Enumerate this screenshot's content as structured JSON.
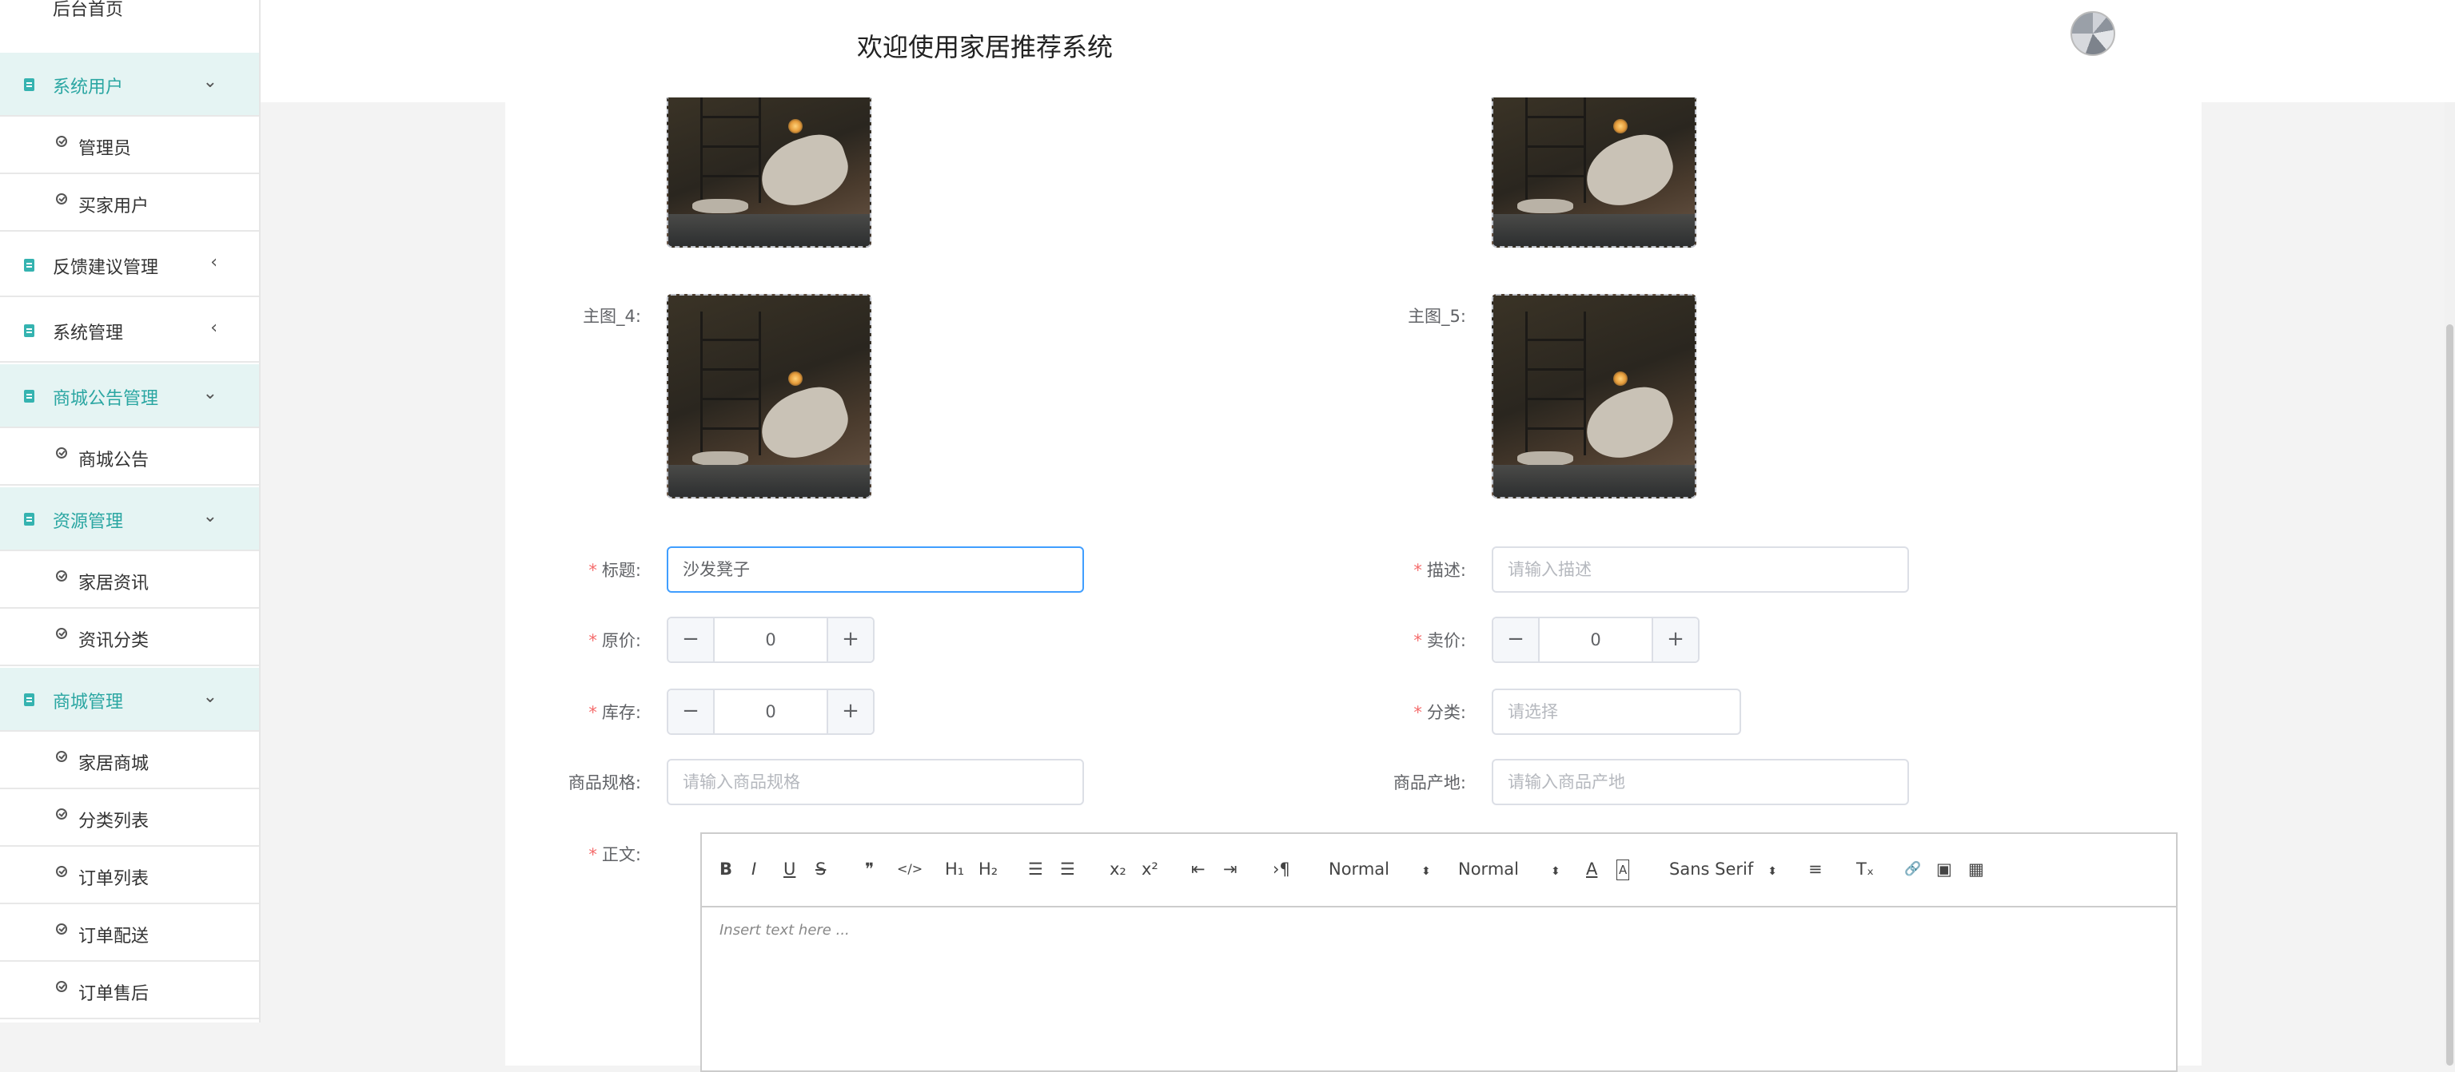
{
  "sidebar": {
    "home": "后台首页",
    "groups": [
      {
        "label": "系统用户",
        "arrow": "⌄",
        "children": [
          "管理员",
          "买家用户"
        ]
      },
      {
        "label": "反馈建议管理",
        "arrow": "‹"
      },
      {
        "label": "系统管理",
        "arrow": "‹"
      },
      {
        "label": "商城公告管理",
        "arrow": "⌄",
        "children": [
          "商城公告"
        ]
      },
      {
        "label": "资源管理",
        "arrow": "⌄",
        "children": [
          "家居资讯",
          "资讯分类"
        ]
      },
      {
        "label": "商城管理",
        "arrow": "⌄",
        "children": [
          "家居商城",
          "分类列表",
          "订单列表",
          "订单配送",
          "订单售后"
        ]
      }
    ]
  },
  "header": {
    "title": "欢迎使用家居推荐系统"
  },
  "form": {
    "main_image_4_label": "主图_4:",
    "main_image_5_label": "主图_5:",
    "title": {
      "label": "标题:",
      "value": "沙发凳子",
      "required": "*"
    },
    "description": {
      "label": "描述:",
      "placeholder": "请输入描述",
      "required": "*"
    },
    "original_price": {
      "label": "原价:",
      "value": "0",
      "required": "*"
    },
    "sale_price": {
      "label": "卖价:",
      "value": "0",
      "required": "*"
    },
    "stock": {
      "label": "库存:",
      "value": "0",
      "required": "*"
    },
    "category": {
      "label": "分类:",
      "placeholder": "请选择",
      "required": "*"
    },
    "spec": {
      "label": "商品规格:",
      "placeholder": "请输入商品规格"
    },
    "origin": {
      "label": "商品产地:",
      "placeholder": "请输入商品产地"
    },
    "body": {
      "label": "正文:",
      "required": "*"
    },
    "stepper_minus": "−",
    "stepper_plus": "+"
  },
  "editor": {
    "toolbar": {
      "bold": "B",
      "italic": "I",
      "underline": "U",
      "strike": "S",
      "blockquote": "❞",
      "code": "</>",
      "h1": "H₁",
      "h2": "H₂",
      "ordered_list": "☰",
      "bullet_list": "☰",
      "subscript": "x₂",
      "superscript": "x²",
      "outdent": "⇤",
      "indent": "⇥",
      "direction": "›¶",
      "size_select": "Normal",
      "header_select": "Normal",
      "color": "A",
      "background": "A",
      "font_select": "Sans Serif",
      "align": "≡",
      "clean": "Tₓ",
      "link": "🔗",
      "image": "▣",
      "video": "▦",
      "select_caret": "⬍"
    },
    "placeholder": "Insert text here ..."
  }
}
